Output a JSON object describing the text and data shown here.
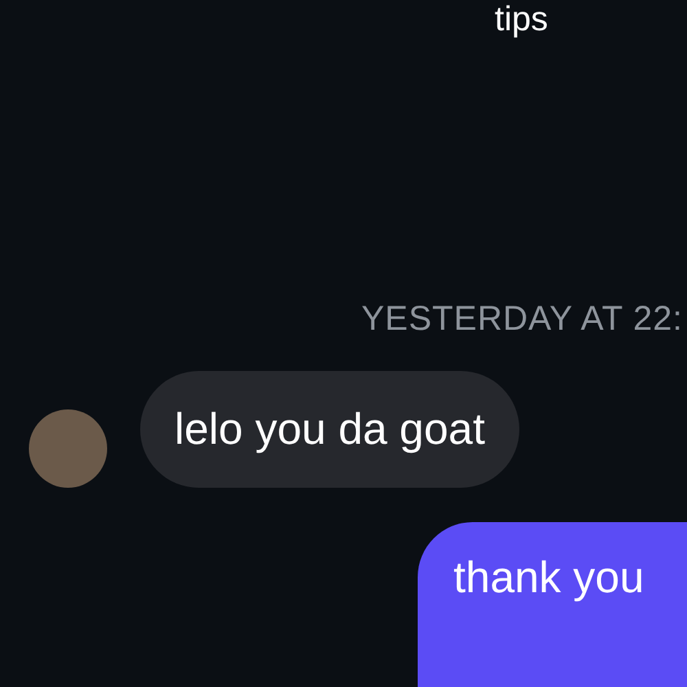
{
  "messages": [
    {
      "kind": "outgoing_tail",
      "text": "tips"
    },
    {
      "kind": "timestamp",
      "text": "YESTERDAY AT 22:"
    },
    {
      "kind": "incoming",
      "text": "lelo you da goat"
    },
    {
      "kind": "outgoing",
      "text": "thank you"
    }
  ]
}
